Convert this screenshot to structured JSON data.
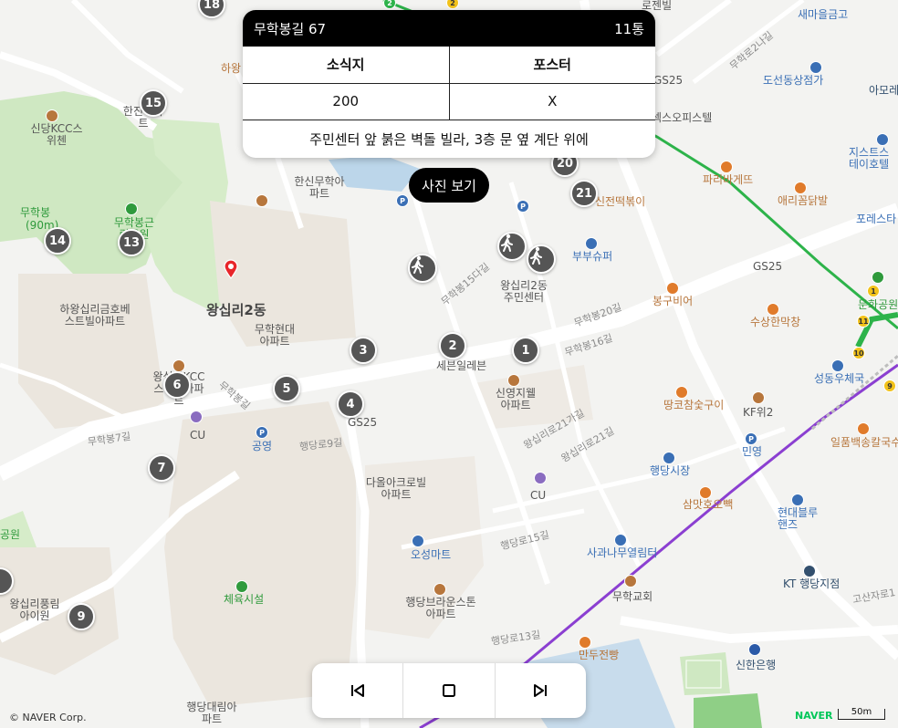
{
  "popup": {
    "address": "무학봉길 67",
    "count": "11통",
    "col1_header": "소식지",
    "col2_header": "포스터",
    "col1_value": "200",
    "col2_value": "X",
    "description": "주민센터 앞 붉은 벽돌 빌라, 3층 문 옆 계단 위에"
  },
  "photo_button": "사진 보기",
  "copyright": "© NAVER Corp.",
  "naver_logo": "NAVER",
  "scale_label": "50m",
  "clusters": [
    "18",
    "15",
    "14",
    "13",
    "20",
    "21",
    "3",
    "2",
    "1",
    "5",
    "4",
    "6",
    "7",
    "9"
  ],
  "map_labels": {
    "wangsimni2dong": "왕십리2동",
    "muhakbong": "무학봉",
    "muhakbong_height": "(90m)",
    "muhakbong_park": "무학봉근린공원",
    "sindang_kcc": "신당KCC스위첸",
    "hanjin": "한진아파트",
    "hansin_muhak": "한신무학아파트",
    "hawang_kumho": "하왕십리금호베스트빌아파트",
    "muhak_hyundai": "무학현대아파트",
    "wangsimni_kcc": "왕십리KCC스위트아파트",
    "wangsimni_2dong_center": "왕십리2동주민센터",
    "seven_eleven": "세븐일레븐",
    "sinyoung_jiwell": "신영지웰아파트",
    "daol_acro": "다올아크로빌아파트",
    "gs25_a": "GS25",
    "gs25_b": "GS25",
    "gs25_c": "GS25",
    "cu_a": "CU",
    "cu_b": "CU",
    "gongyeong": "공영",
    "minyeong": "민영",
    "osung_mart": "오성마트",
    "sinjeon": "신전떡볶이",
    "bubu_super": "부부슈퍼",
    "bonggu_beer": "봉구비어",
    "suhsang": "수상한막창",
    "ddangko": "땅코참숯구이",
    "kf_wi2": "KF위2",
    "haengdang_market": "행당시장",
    "samtaek": "삼맛호오빽",
    "sagwa": "사과나무열림터",
    "muhak_church": "무학교회",
    "mandu": "만두전빵",
    "haengdang_brownstone": "행당브라운스톤아파트",
    "haengdang_daerim": "행당대림아파트",
    "sports": "체육시설",
    "wangsimni_pungrim": "왕십리풍림아이원",
    "paris": "파리바게뜨",
    "aeri": "애리꼼닭발",
    "jeoseuteu": "지스트스테이호텔",
    "foreset": "포레스타",
    "ilpum": "일품백송칼국수",
    "hyundai_bluehands": "현대블루핸즈",
    "kt": "KT 행당지점",
    "shinhan": "신한은행",
    "seongdong_post": "성동우체국",
    "munhwa_park": "문화공원",
    "saemaeul": "새마을금고",
    "doseon": "도선동상점가",
    "amore": "아모레",
    "rotel": "로젠빌",
    "sinnamu": "섹스오피스텔",
    "hawang_s": "하왕",
    "park_label": "공원",
    "road_muhakbong7": "무학봉7길",
    "road_haengdang9": "행당로9길",
    "road_muhakbong15": "무학봉15다길",
    "road_muhakbong20": "무학봉20길",
    "road_muhakbong16": "무학봉16길",
    "road_wangsimni21": "왕십리로21길",
    "road_wangsimni21ga": "왕십리로21가길",
    "road_haengdang15": "행당로15길",
    "road_haengdang13": "행당로13길",
    "road_gosanja": "고산자로1",
    "road_muhakbong": "무학봉길",
    "road_doseondong": "무학로2나길"
  },
  "colors": {
    "map_bg": "#f3f3f1",
    "park": "#cfe8c2",
    "road": "#ffffff",
    "line2_green": "#2db34a",
    "line5_purple": "#8b3fd1",
    "cluster": "#555555",
    "marker_red": "#e8262b"
  },
  "icons": [
    "walker-icon",
    "marker-pin-icon",
    "prev-icon",
    "stop-icon",
    "next-icon"
  ],
  "controls": {
    "prev": "previous",
    "stop": "stop",
    "next": "next"
  }
}
